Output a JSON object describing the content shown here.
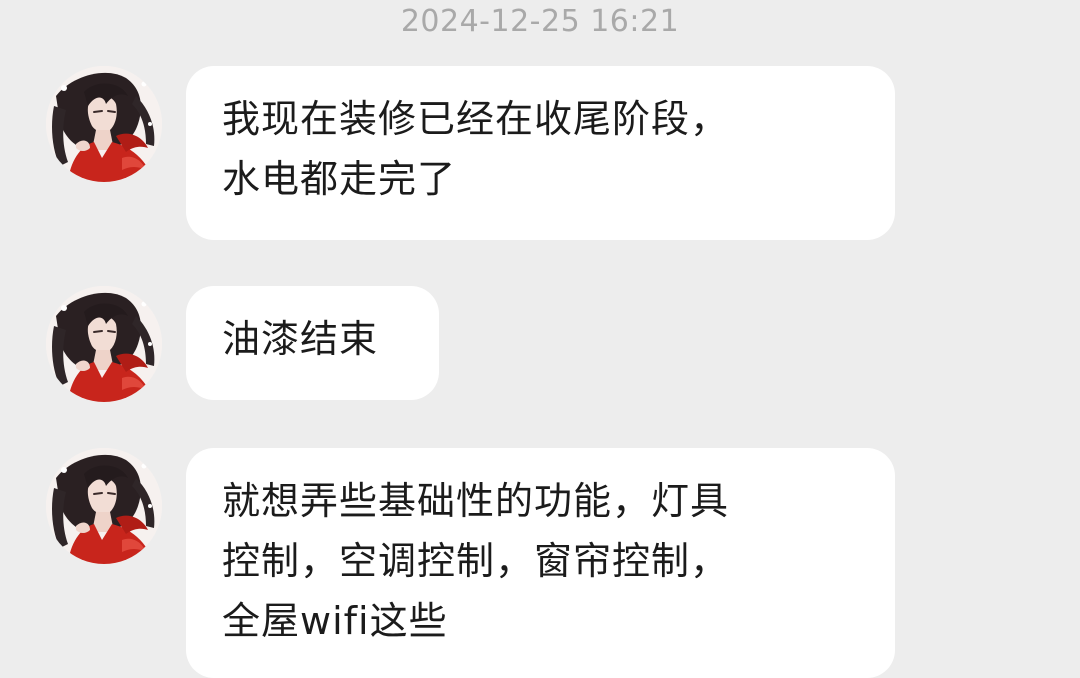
{
  "chat": {
    "timestamp": "2024-12-25 16:21",
    "messages": [
      {
        "sender_avatar": "user-avatar-dark-hair-red-robe",
        "lines": [
          "我现在装修已经在收尾阶段，",
          "水电都走完了"
        ]
      },
      {
        "sender_avatar": "user-avatar-dark-hair-red-robe",
        "lines": [
          "油漆结束"
        ]
      },
      {
        "sender_avatar": "user-avatar-dark-hair-red-robe",
        "lines": [
          "就想弄些基础性的功能，灯具",
          "控制，空调控制，窗帘控制，",
          "全屋wifi这些"
        ]
      }
    ]
  },
  "colors": {
    "background": "#ededed",
    "bubble": "#ffffff",
    "timestamp_text": "#a9a9a9",
    "message_text": "#1b1b1b",
    "avatar_robe": "#c8251c"
  }
}
